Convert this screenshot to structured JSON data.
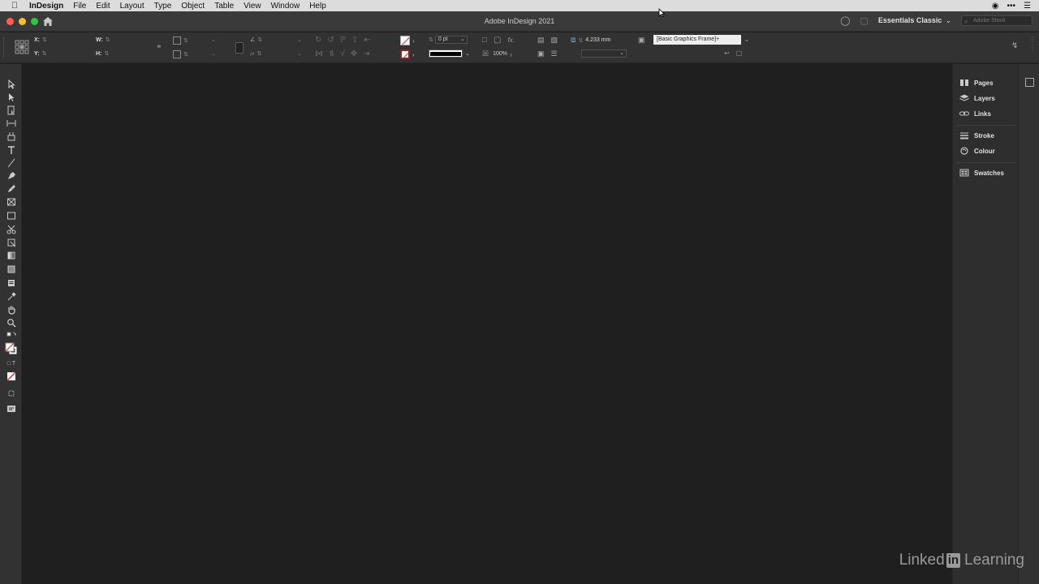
{
  "menubar": {
    "items": [
      "InDesign",
      "File",
      "Edit",
      "Layout",
      "Type",
      "Object",
      "Table",
      "View",
      "Window",
      "Help"
    ]
  },
  "window": {
    "title": "Adobe InDesign 2021",
    "workspace": "Essentials Classic",
    "stock_search_placeholder": "Adobe Stock"
  },
  "control": {
    "x_label": "X:",
    "y_label": "Y:",
    "w_label": "W:",
    "h_label": "H:",
    "stroke_weight": "0 pt",
    "opacity": "100%",
    "fitting_value": "4.233 mm",
    "object_style": "[Basic Graphics Frame]+",
    "fx_label": "fx."
  },
  "dock": {
    "items": [
      "Pages",
      "Layers",
      "Links",
      "Stroke",
      "Colour",
      "Swatches"
    ]
  },
  "watermark": {
    "left": "Linked",
    "mid": "in",
    "right": "Learning"
  },
  "colors": {
    "fill_none_slash": "#e03030",
    "canvas": "#1f1f1f"
  }
}
